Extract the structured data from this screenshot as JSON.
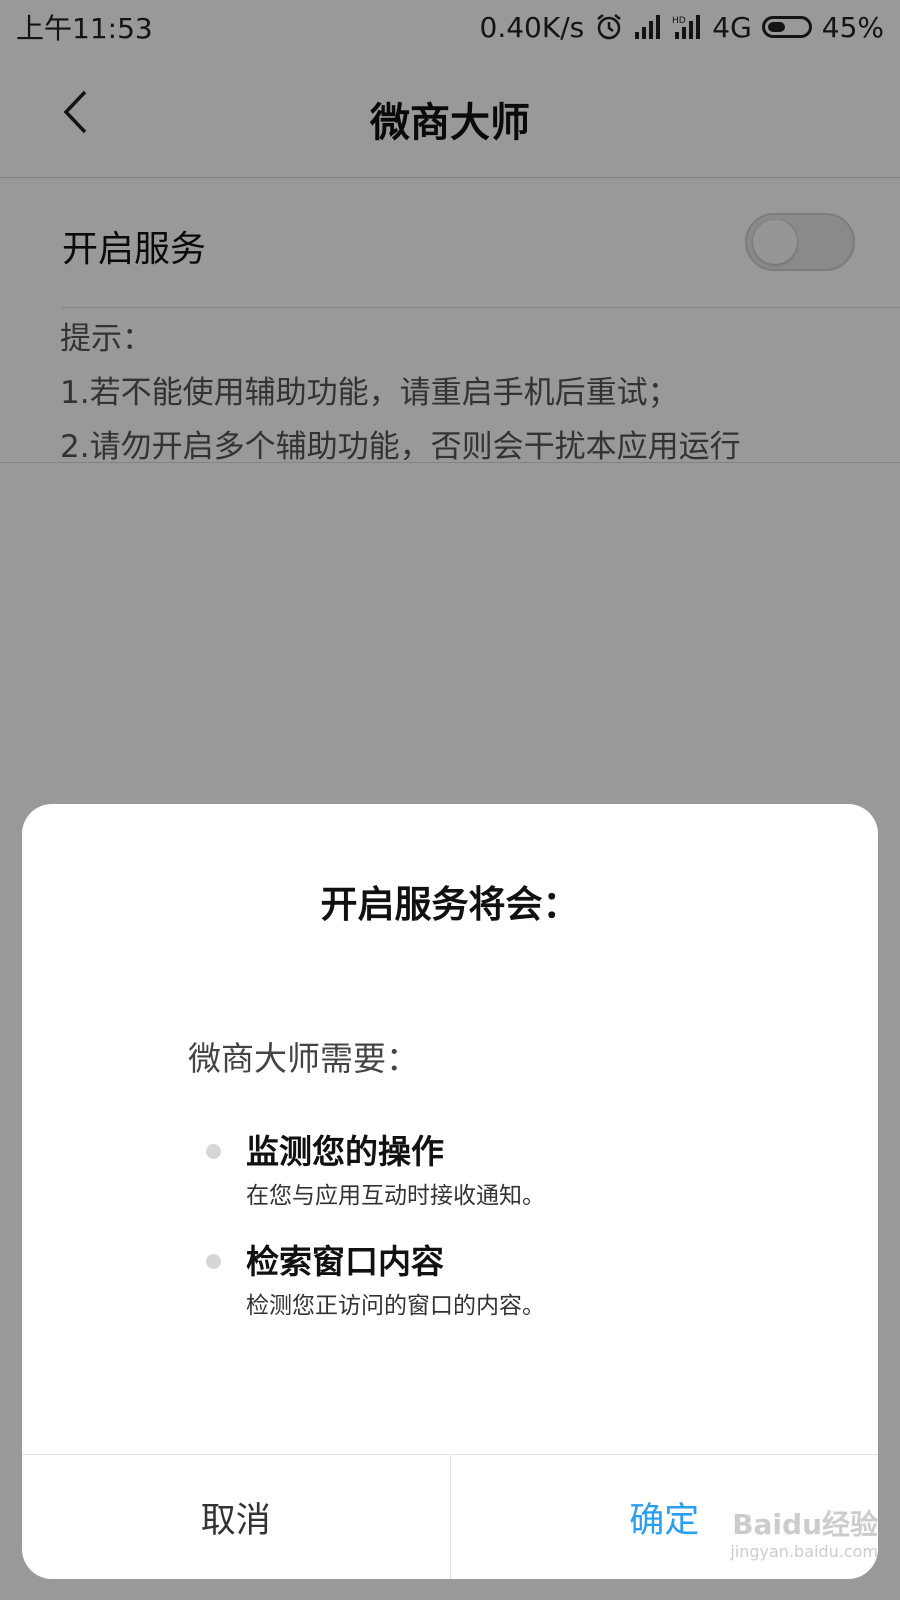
{
  "status_bar": {
    "time": "上午11:53",
    "network_speed": "0.40K/s",
    "network_type": "4G",
    "battery": "45%",
    "battery_level": 0.45,
    "icons": [
      "alarm-icon",
      "signal-icon",
      "hd-signal-icon",
      "battery-icon"
    ]
  },
  "header": {
    "title": "微商大师",
    "back_icon": "chevron-left-icon"
  },
  "settings": {
    "service_label": "开启服务",
    "service_enabled": false
  },
  "hints": {
    "heading": "提示：",
    "lines": [
      "1.若不能使用辅助功能，请重启手机后重试；",
      "2.请勿开启多个辅助功能，否则会干扰本应用运行"
    ]
  },
  "dialog": {
    "title": "开启服务将会：",
    "intro": "微商大师需要：",
    "permissions": [
      {
        "title": "监测您的操作",
        "description": "在您与应用互动时接收通知。"
      },
      {
        "title": "检索窗口内容",
        "description": "检测您正访问的窗口的内容。"
      }
    ],
    "cancel_label": "取消",
    "confirm_label": "确定"
  },
  "watermark": {
    "text": "Baidu经验",
    "url": "jingyan.baidu.com"
  },
  "colors": {
    "accent": "#2a9ff0",
    "overlay": "rgba(0,0,0,0.4)"
  }
}
